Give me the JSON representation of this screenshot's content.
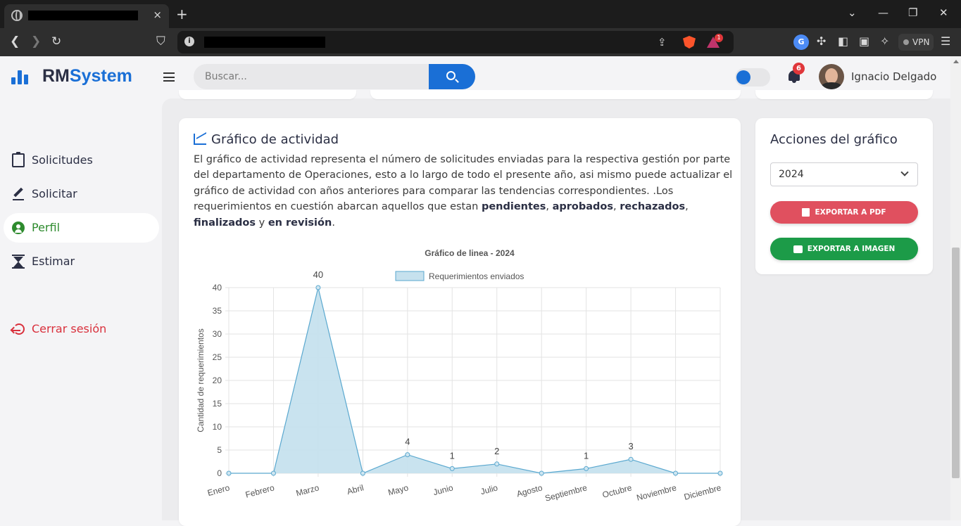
{
  "browser": {
    "tab_close": "×",
    "new_tab": "+",
    "vpn_label": "VPN",
    "shield_badge": "1",
    "translate_glyph": "G"
  },
  "app": {
    "logo_rm": "RM",
    "logo_system": "System",
    "search_placeholder": "Buscar...",
    "notifications_count": "6",
    "user_name": "Ignacio Delgado"
  },
  "sidebar": {
    "items": [
      {
        "label": "Solicitudes"
      },
      {
        "label": "Solicitar"
      },
      {
        "label": "Perfil"
      },
      {
        "label": "Estimar"
      }
    ],
    "logout_label": "Cerrar sesión"
  },
  "activity": {
    "title": "Gráfico de actividad",
    "desc_intro": "El gráfico de actividad representa el número de solicitudes enviadas para la respectiva gestión por parte del departamento de Operaciones, esto a lo largo de todo el presente año, asi mismo puede actualizar el gráfico de actividad con años anteriores para comparar las tendencias correspondientes. .Los requerimientos en cuestión abarcan aquellos que estan ",
    "kw1": "pendientes",
    "sep1": ", ",
    "kw2": "aprobados",
    "sep2": ", ",
    "kw3": "rechazados",
    "sep3": ", ",
    "kw4": "finalizados",
    "sep4": " y ",
    "kw5": "en revisión",
    "end": "."
  },
  "actions": {
    "title": "Acciones del gráfico",
    "year_selected": "2024",
    "pdf_button": "EXPORTAR A PDF",
    "image_button": "EXPORTAR A IMAGEN"
  },
  "colors": {
    "brand_blue": "#1a6fd6",
    "pdf_red": "#e0505f",
    "image_green": "#1c9b48",
    "line": "#5aa8cf",
    "fill": "#c6e1ee"
  },
  "chart_data": {
    "type": "area",
    "title": "Gráfico de linea - 2024",
    "ylabel": "Cantidad de requerimientos",
    "xlabel": "",
    "legend": "top",
    "categories": [
      "Enero",
      "Febrero",
      "Marzo",
      "Abril",
      "Mayo",
      "Junio",
      "Julio",
      "Agosto",
      "Septiembre",
      "Octubre",
      "Noviembre",
      "Diciembre"
    ],
    "series": [
      {
        "name": "Requerimientos enviados",
        "values": [
          0,
          0,
          40,
          0,
          4,
          1,
          2,
          0,
          1,
          3,
          0,
          0
        ]
      }
    ],
    "data_labels": [
      "",
      "",
      "40",
      "",
      "4",
      "1",
      "2",
      "",
      "1",
      "3",
      "",
      ""
    ],
    "ylim": [
      0,
      40
    ],
    "yticks": [
      0,
      5,
      10,
      15,
      20,
      25,
      30,
      35,
      40
    ],
    "grid": true
  }
}
